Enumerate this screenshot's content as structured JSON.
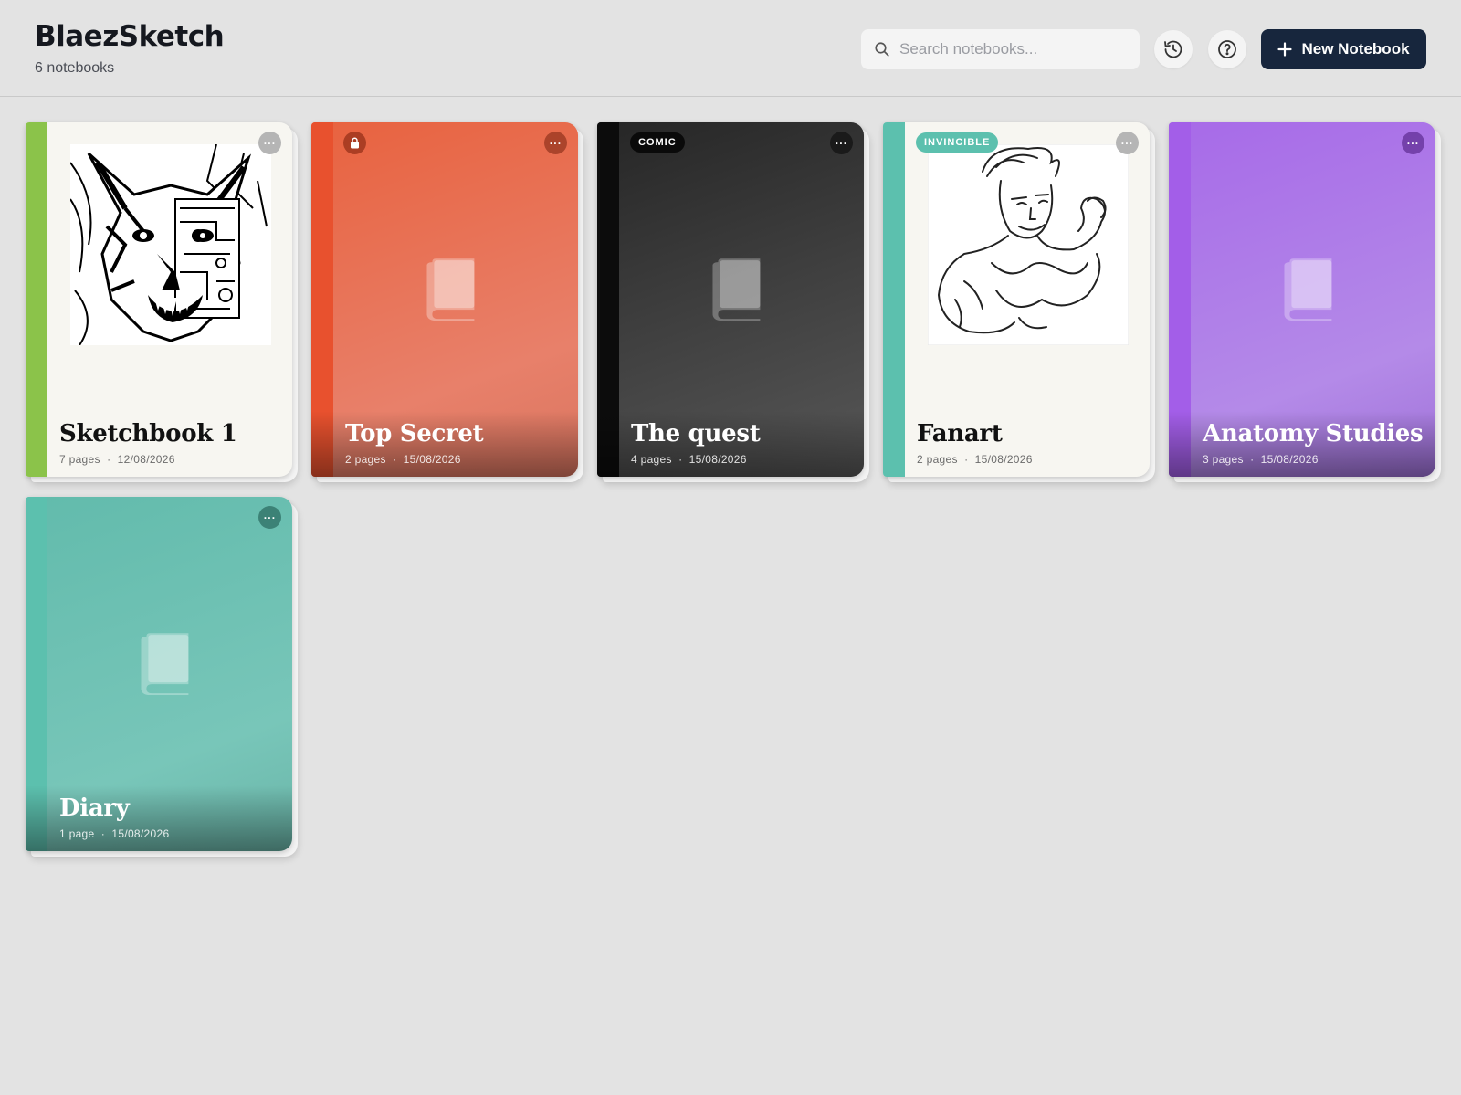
{
  "app": {
    "title": "BlaezSketch",
    "notebook_count": "6 notebooks"
  },
  "search": {
    "placeholder": "Search notebooks..."
  },
  "toolbar": {
    "history_icon": "history-icon",
    "help_icon": "help-icon",
    "new_notebook_label": "New Notebook"
  },
  "notebooks": [
    {
      "title": "Sketchbook 1",
      "pages": "7 pages",
      "date": "12/08/2026",
      "cover": "wolf-cyborg-sketch",
      "spine_color": "#8bc34a",
      "bg": "#f7f6f1"
    },
    {
      "title": "Top Secret",
      "pages": "2 pages",
      "date": "15/08/2026",
      "locked": true,
      "spine_color": "#e8512e",
      "bg": "#e8694d"
    },
    {
      "title": "The quest",
      "pages": "4 pages",
      "date": "15/08/2026",
      "badge": "COMIC",
      "spine_color": "#0c0c0c",
      "bg": "#3a3a3a"
    },
    {
      "title": "Fanart",
      "pages": "2 pages",
      "date": "15/08/2026",
      "badge": "INVINCIBLE",
      "cover": "superhero-sketch",
      "spine_color": "#5cc0ae",
      "bg": "#f7f6f1"
    },
    {
      "title": "Anatomy Studies",
      "pages": "3 pages",
      "date": "15/08/2026",
      "spine_color": "#a35ee8",
      "bg": "#b07ae8"
    },
    {
      "title": "Diary",
      "pages": "1 page",
      "date": "15/08/2026",
      "spine_color": "#5cc0ae",
      "bg": "#6dc2b4"
    }
  ],
  "separator": "·",
  "more_label": "···"
}
